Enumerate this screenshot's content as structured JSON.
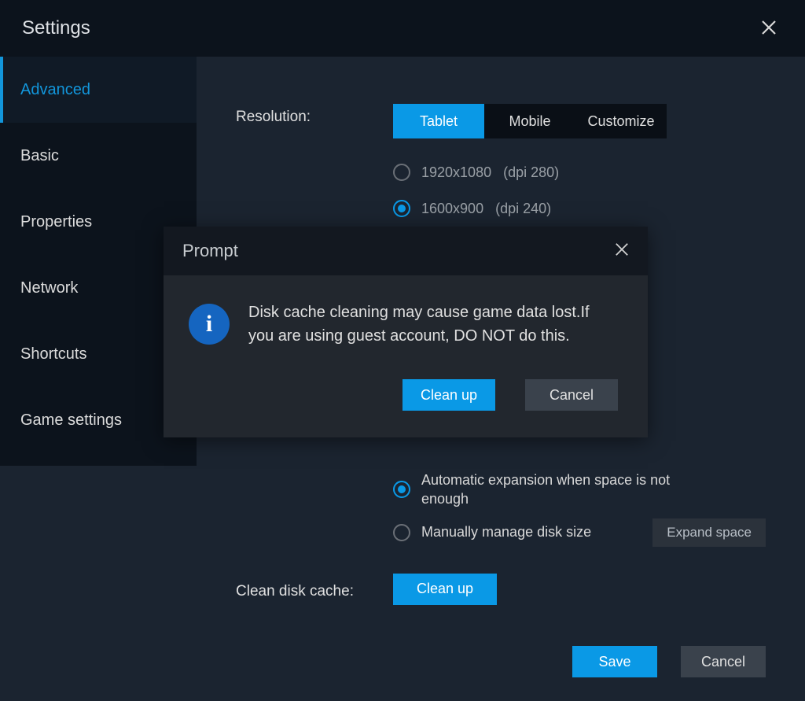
{
  "header": {
    "title": "Settings"
  },
  "sidebar": {
    "items": [
      {
        "label": "Advanced",
        "active": true
      },
      {
        "label": "Basic"
      },
      {
        "label": "Properties"
      },
      {
        "label": "Network"
      },
      {
        "label": "Shortcuts"
      },
      {
        "label": "Game settings"
      }
    ]
  },
  "main": {
    "resolution_label": "Resolution:",
    "segments": {
      "tablet": "Tablet",
      "mobile": "Mobile",
      "customize": "Customize"
    },
    "resolutions": [
      {
        "res": "1920x1080",
        "dpi": "(dpi 280)",
        "selected": false
      },
      {
        "res": "1600x900",
        "dpi": "(dpi 240)",
        "selected": true
      }
    ],
    "disk": {
      "auto_label": "Automatic expansion when space is not enough",
      "manual_label": "Manually manage disk size",
      "expand_button": "Expand space"
    },
    "clean_label": "Clean disk cache:",
    "clean_button": "Clean up"
  },
  "footer": {
    "save": "Save",
    "cancel": "Cancel"
  },
  "modal": {
    "title": "Prompt",
    "message": "Disk cache cleaning may cause game data lost.If you are using guest account, DO NOT do this.",
    "cleanup": "Clean up",
    "cancel": "Cancel",
    "info_glyph": "i"
  }
}
